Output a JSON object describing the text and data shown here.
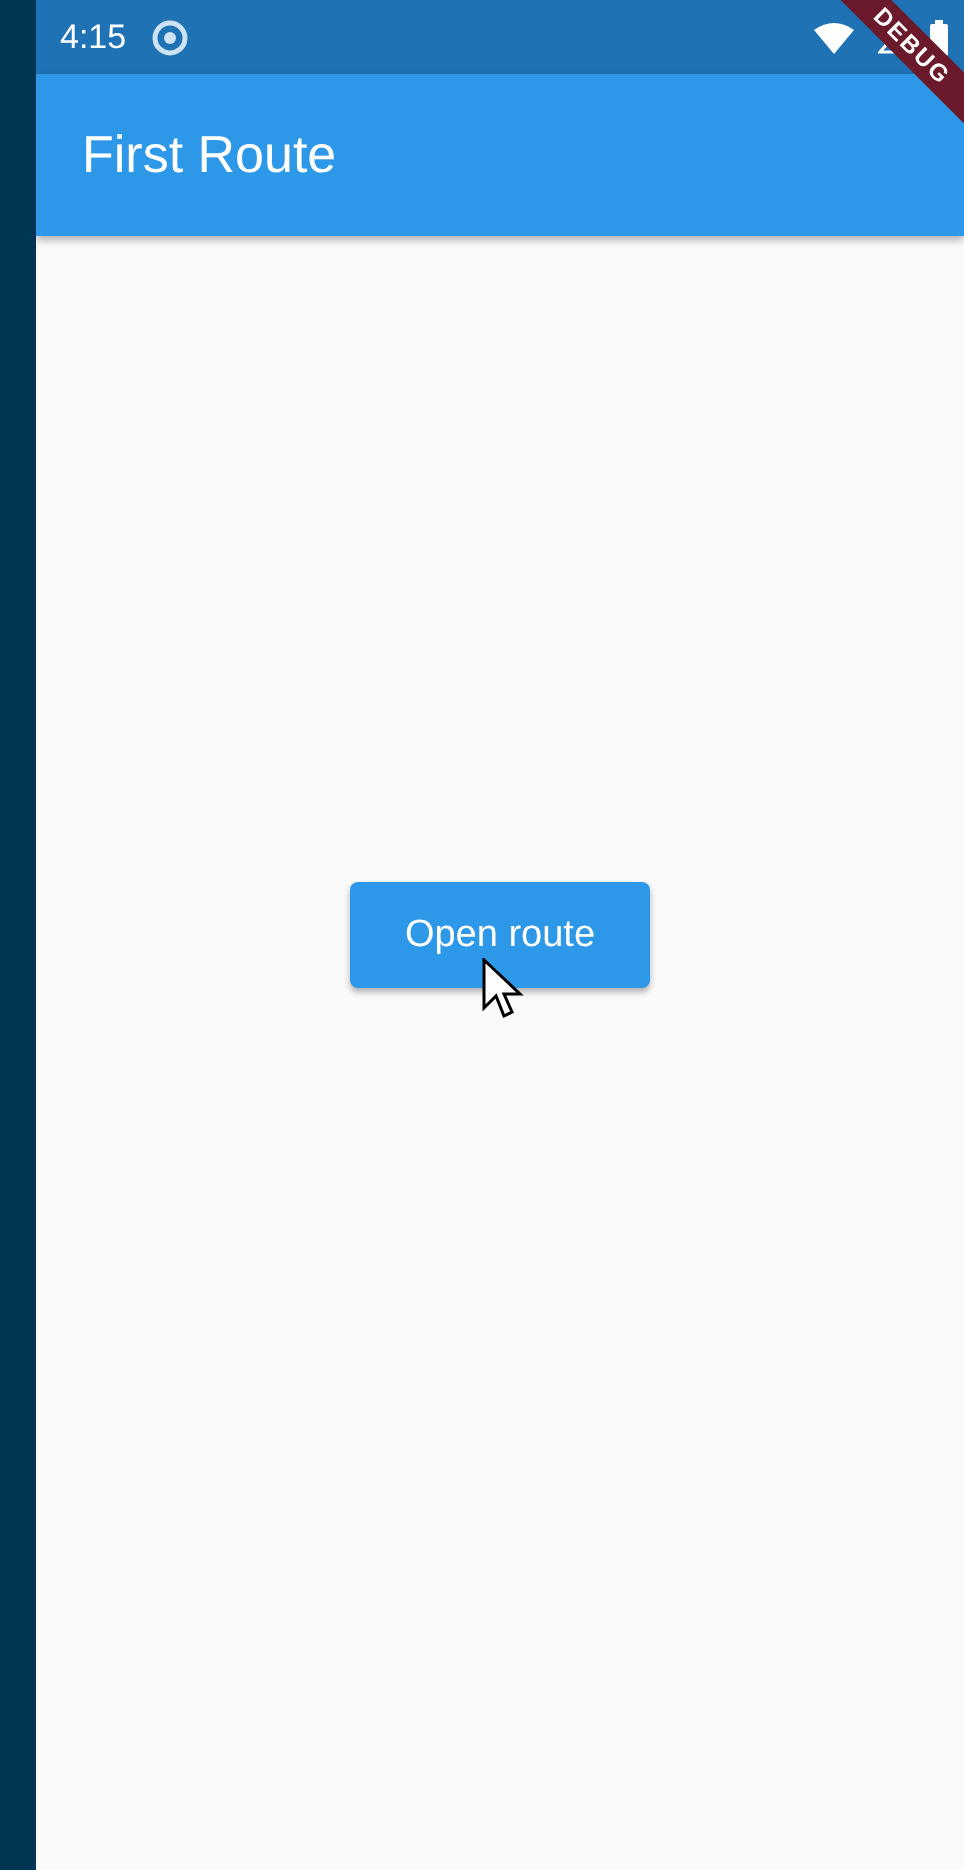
{
  "status_bar": {
    "time": "4:15"
  },
  "app_bar": {
    "title": "First Route"
  },
  "body": {
    "button": {
      "label": "Open route"
    }
  },
  "debug_banner": {
    "label": "DEBUG"
  }
}
